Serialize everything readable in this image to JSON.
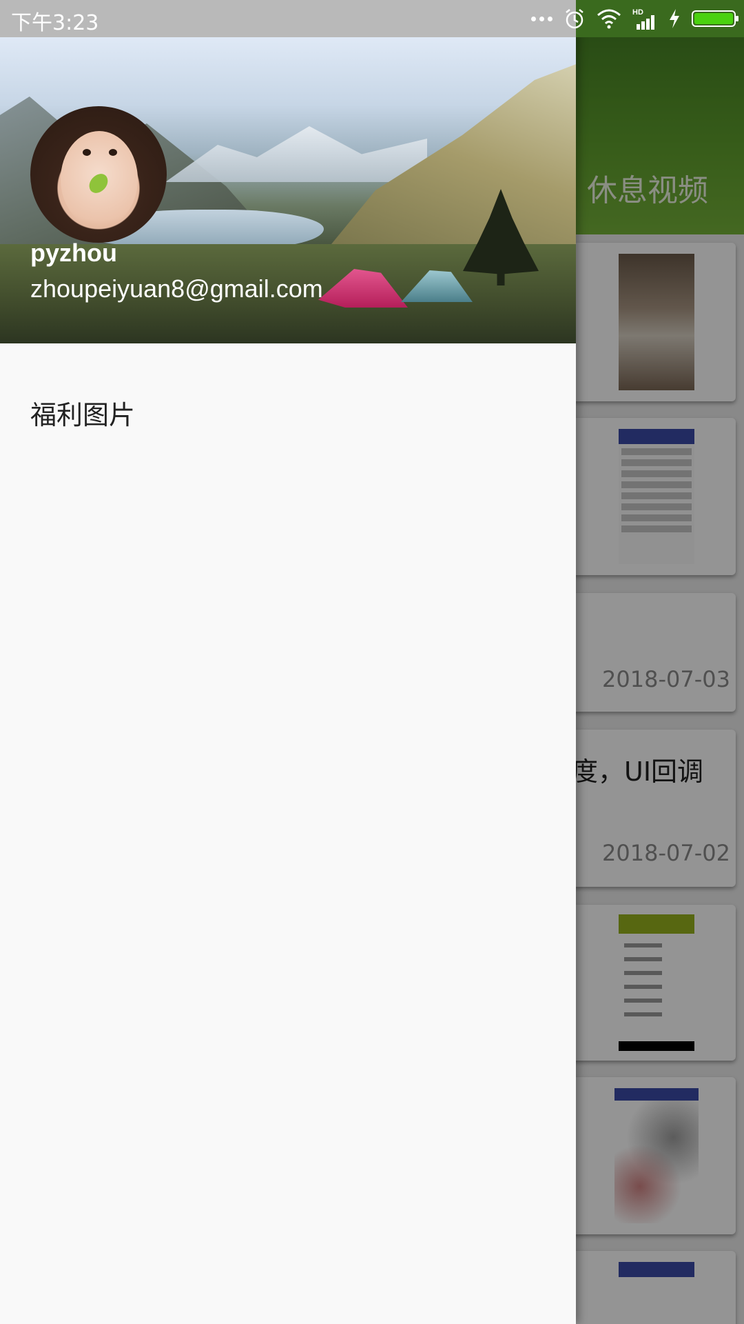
{
  "status_bar": {
    "time": "下午3:23",
    "icons": [
      "more-dots-icon",
      "alarm-icon",
      "wifi-icon",
      "hd-signal-icon",
      "charging-icon",
      "battery-icon"
    ],
    "battery_color": "#4ad10f"
  },
  "drawer": {
    "user": {
      "name": "pyzhou",
      "email": "zhoupeiyuan8@gmail.com"
    },
    "menu_items": [
      {
        "label": "福利图片"
      }
    ]
  },
  "background_app": {
    "appbar_color": "#5e9e2c",
    "visible_tab": "休息视频",
    "cards": [
      {
        "text": "",
        "date": ""
      },
      {
        "text": "",
        "date": ""
      },
      {
        "text": "",
        "date": "2018-07-03"
      },
      {
        "text": "度，UI回调",
        "date": "2018-07-02"
      },
      {
        "text": "",
        "date": ""
      },
      {
        "text": "",
        "date": ""
      },
      {
        "text": "",
        "date": ""
      }
    ]
  }
}
